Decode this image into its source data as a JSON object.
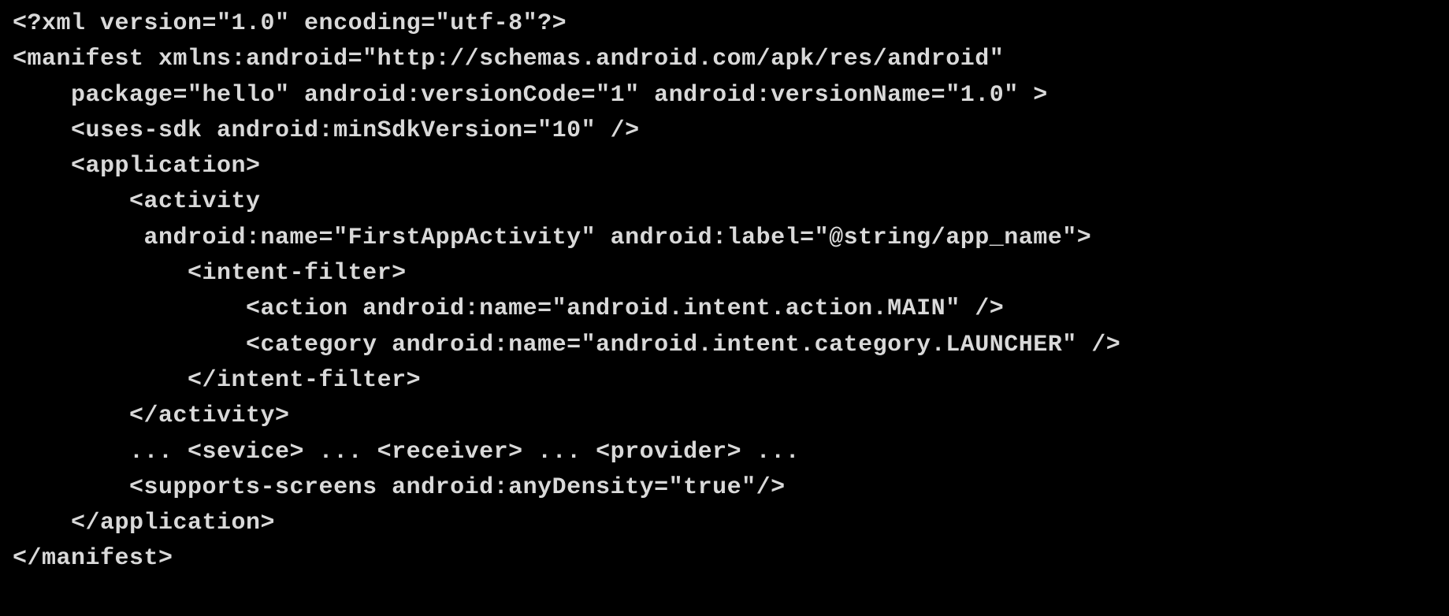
{
  "code": {
    "lines": [
      "<?xml version=\"1.0\" encoding=\"utf-8\"?>",
      "<manifest xmlns:android=\"http://schemas.android.com/apk/res/android\"",
      "    package=\"hello\" android:versionCode=\"1\" android:versionName=\"1.0\" >",
      "    <uses-sdk android:minSdkVersion=\"10\" />",
      "    <application>",
      "        <activity",
      "         android:name=\"FirstAppActivity\" android:label=\"@string/app_name\">",
      "            <intent-filter>",
      "                <action android:name=\"android.intent.action.MAIN\" />",
      "                <category android:name=\"android.intent.category.LAUNCHER\" />",
      "            </intent-filter>",
      "        </activity>",
      "        ... <sevice> ... <receiver> ... <provider> ...",
      "        <supports-screens android:anyDensity=\"true\"/>",
      "    </application>",
      "</manifest>"
    ]
  }
}
